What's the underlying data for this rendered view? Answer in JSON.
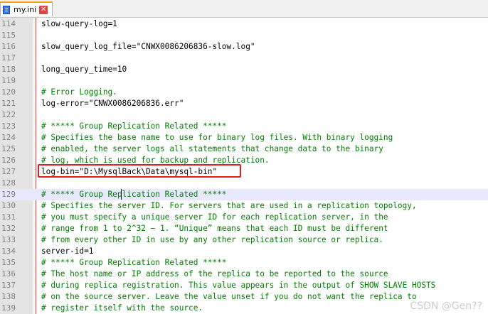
{
  "tab": {
    "filename": "my.ini",
    "close_glyph": "✕"
  },
  "lines": [
    {
      "n": "114",
      "text": "slow-query-log=1",
      "type": "code"
    },
    {
      "n": "115",
      "text": "",
      "type": "code"
    },
    {
      "n": "116",
      "text": "slow_query_log_file=\"CNWX0086206836-slow.log\"",
      "type": "code"
    },
    {
      "n": "117",
      "text": "",
      "type": "code"
    },
    {
      "n": "118",
      "text": "long_query_time=10",
      "type": "code"
    },
    {
      "n": "119",
      "text": "",
      "type": "code"
    },
    {
      "n": "120",
      "text": "# Error Logging.",
      "type": "comment"
    },
    {
      "n": "121",
      "text": "log-error=\"CNWX0086206836.err\"",
      "type": "code"
    },
    {
      "n": "122",
      "text": "",
      "type": "code"
    },
    {
      "n": "123",
      "text": "# ***** Group Replication Related *****",
      "type": "comment"
    },
    {
      "n": "124",
      "text": "# Specifies the base name to use for binary log files. With binary logging",
      "type": "comment"
    },
    {
      "n": "125",
      "text": "# enabled, the server logs all statements that change data to the binary",
      "type": "comment"
    },
    {
      "n": "126",
      "text": "# log, which is used for backup and replication.",
      "type": "comment"
    },
    {
      "n": "127",
      "text": "log-bin=\"D:\\MysqlBack\\Data\\mysql-bin\"",
      "type": "code"
    },
    {
      "n": "128",
      "text": "",
      "type": "code"
    },
    {
      "n": "129",
      "text": "# ***** Group Replication Related *****",
      "type": "comment",
      "current": true
    },
    {
      "n": "130",
      "text": "# Specifies the server ID. For servers that are used in a replication topology,",
      "type": "comment"
    },
    {
      "n": "131",
      "text": "# you must specify a unique server ID for each replication server, in the",
      "type": "comment"
    },
    {
      "n": "132",
      "text": "# range from 1 to 2^32 − 1. “Unique” means that each ID must be different",
      "type": "comment"
    },
    {
      "n": "133",
      "text": "# from every other ID in use by any other replication source or replica.",
      "type": "comment"
    },
    {
      "n": "134",
      "text": "server-id=1",
      "type": "code"
    },
    {
      "n": "135",
      "text": "# ***** Group Replication Related *****",
      "type": "comment"
    },
    {
      "n": "136",
      "text": "# The host name or IP address of the replica to be reported to the source",
      "type": "comment"
    },
    {
      "n": "137",
      "text": "# during replica registration. This value appears in the output of SHOW SLAVE HOSTS",
      "type": "comment"
    },
    {
      "n": "138",
      "text": "# on the source server. Leave the value unset if you do not want the replica to",
      "type": "comment"
    },
    {
      "n": "139",
      "text": "# register itself with the source.",
      "type": "comment"
    }
  ],
  "watermark": "CSDN @Gen??",
  "colors": {
    "comment": "#008000",
    "highlight_box": "#e02020",
    "margin_line": "#e43b3b"
  }
}
